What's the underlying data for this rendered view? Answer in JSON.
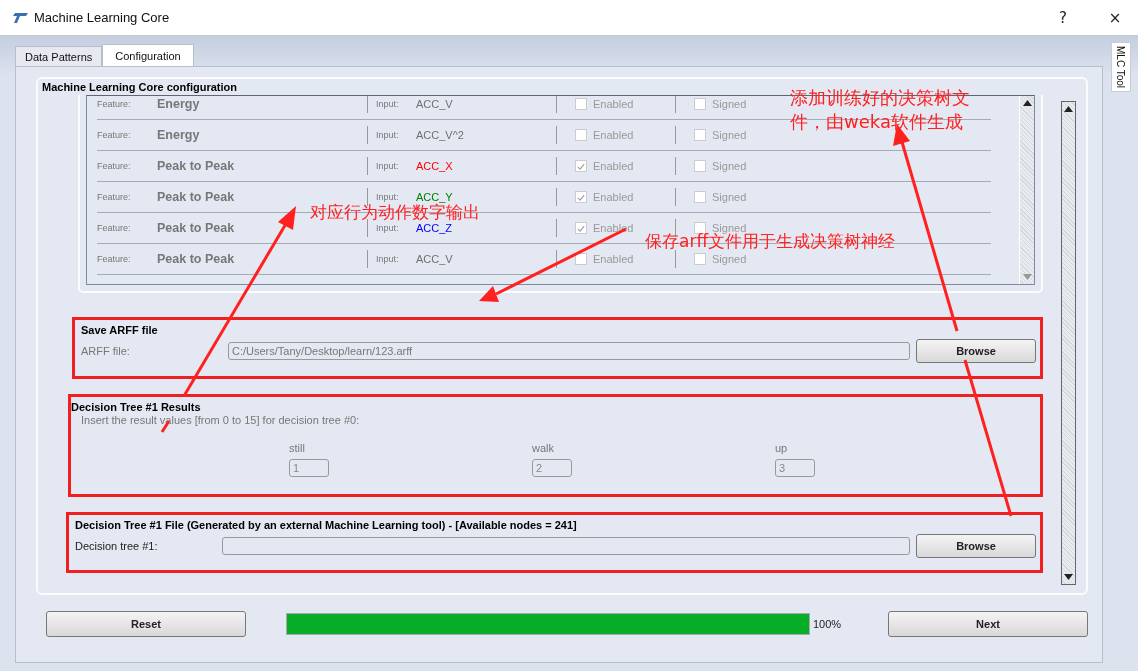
{
  "window": {
    "title": "Machine Learning Core",
    "buttons": [
      "?",
      "×"
    ]
  },
  "tabs": [
    {
      "label": "Data Patterns",
      "selected": false
    },
    {
      "label": "Configuration",
      "selected": true
    }
  ],
  "side_tab": {
    "label": "MLC Tool"
  },
  "group": {
    "title": "Machine Learning Core configuration"
  },
  "features": [
    {
      "feature_label": "Feature:",
      "feature": "Energy",
      "input_label": "Input:",
      "input": "ACC_V",
      "color": "#6f6f6f",
      "enabled_label": "Enabled",
      "enabled": false,
      "signed_label": "Signed",
      "signed": false
    },
    {
      "feature_label": "Feature:",
      "feature": "Energy",
      "input_label": "Input:",
      "input": "ACC_V^2",
      "color": "#6f6f6f",
      "enabled_label": "Enabled",
      "enabled": false,
      "signed_label": "Signed",
      "signed": false
    },
    {
      "feature_label": "Feature:",
      "feature": "Peak to Peak",
      "input_label": "Input:",
      "input": "ACC_X",
      "color": "#ff0000",
      "enabled_label": "Enabled",
      "enabled": true,
      "signed_label": "Signed",
      "signed": false
    },
    {
      "feature_label": "Feature:",
      "feature": "Peak to Peak",
      "input_label": "Input:",
      "input": "ACC_Y",
      "color": "#008000",
      "enabled_label": "Enabled",
      "enabled": true,
      "signed_label": "Signed",
      "signed": false
    },
    {
      "feature_label": "Feature:",
      "feature": "Peak to Peak",
      "input_label": "Input:",
      "input": "ACC_Z",
      "color": "#0000ff",
      "enabled_label": "Enabled",
      "enabled": true,
      "signed_label": "Signed",
      "signed": false
    },
    {
      "feature_label": "Feature:",
      "feature": "Peak to Peak",
      "input_label": "Input:",
      "input": "ACC_V",
      "color": "#6f6f6f",
      "enabled_label": "Enabled",
      "enabled": false,
      "signed_label": "Signed",
      "signed": false
    }
  ],
  "save_arff": {
    "title": "Save ARFF file",
    "annotated": true,
    "label": "ARFF file:",
    "value": "C:/Users/Tany/Desktop/learn/123.arff",
    "button": "Browse"
  },
  "results": {
    "title": "Decision Tree #1 Results",
    "annotated": true,
    "hint": "Insert the result values [from 0 to 15] for decision tree #0:",
    "items": [
      {
        "label": "still",
        "value": "1"
      },
      {
        "label": "walk",
        "value": "2"
      },
      {
        "label": "up",
        "value": "3"
      }
    ]
  },
  "tree_file": {
    "title": "Decision Tree #1 File  (Generated by an external Machine Learning tool)   -   [Available nodes = 241]",
    "annotated": true,
    "label": "Decision tree #1:",
    "button": "Browse"
  },
  "footer": {
    "reset": "Reset",
    "progress": {
      "level": 1
    },
    "percent": "100%",
    "next": "Next"
  },
  "notes": [
    {
      "text": "添加训练好的决策树文件，由weka软件生成"
    },
    {
      "text": "对应行为动作数字输出"
    },
    {
      "text": "保存arff文件用于生成决策树神经"
    }
  ]
}
